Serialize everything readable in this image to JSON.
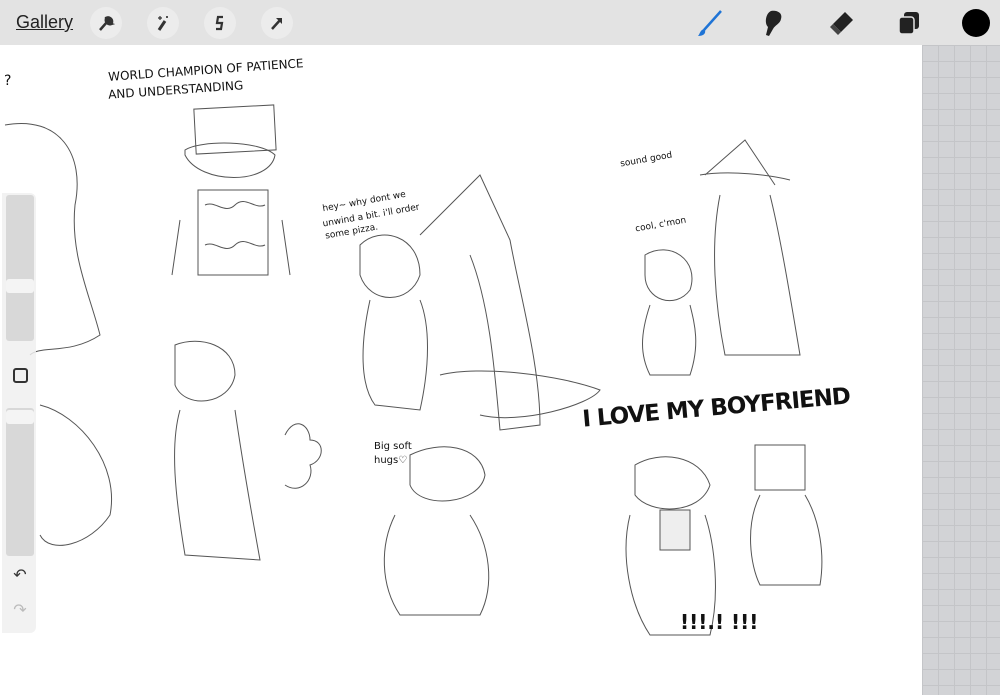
{
  "topbar": {
    "gallery_label": "Gallery",
    "left_tools": [
      "wrench-icon",
      "magic-wand-icon",
      "selection-icon",
      "transform-arrow-icon"
    ],
    "right_tools": [
      "brush-icon",
      "smudge-icon",
      "eraser-icon",
      "layers-icon"
    ],
    "active_tool": "brush",
    "accent": "#1f74d6",
    "current_color": "#000000"
  },
  "sidebar": {
    "brush_size": 0.4,
    "opacity": 0.95,
    "modify_icon": "square-icon",
    "undo_icon": "undo-icon",
    "redo_icon": "redo-icon"
  },
  "canvas": {
    "annotations": {
      "q": "?",
      "champ1": "WORLD CHAMPION OF PATIENCE",
      "champ2": "AND UNDERSTANDING",
      "hey1": "hey~ why dont we",
      "hey2": "unwind a bit. i'll order",
      "hey3": "some pizza.",
      "sound": "sound good",
      "cool": "cool, c'mon",
      "love": "I LOVE MY BOYFRIEND",
      "hug1": "Big soft",
      "hug2": "hugs♡",
      "excl": "!!!.! !!!"
    }
  }
}
